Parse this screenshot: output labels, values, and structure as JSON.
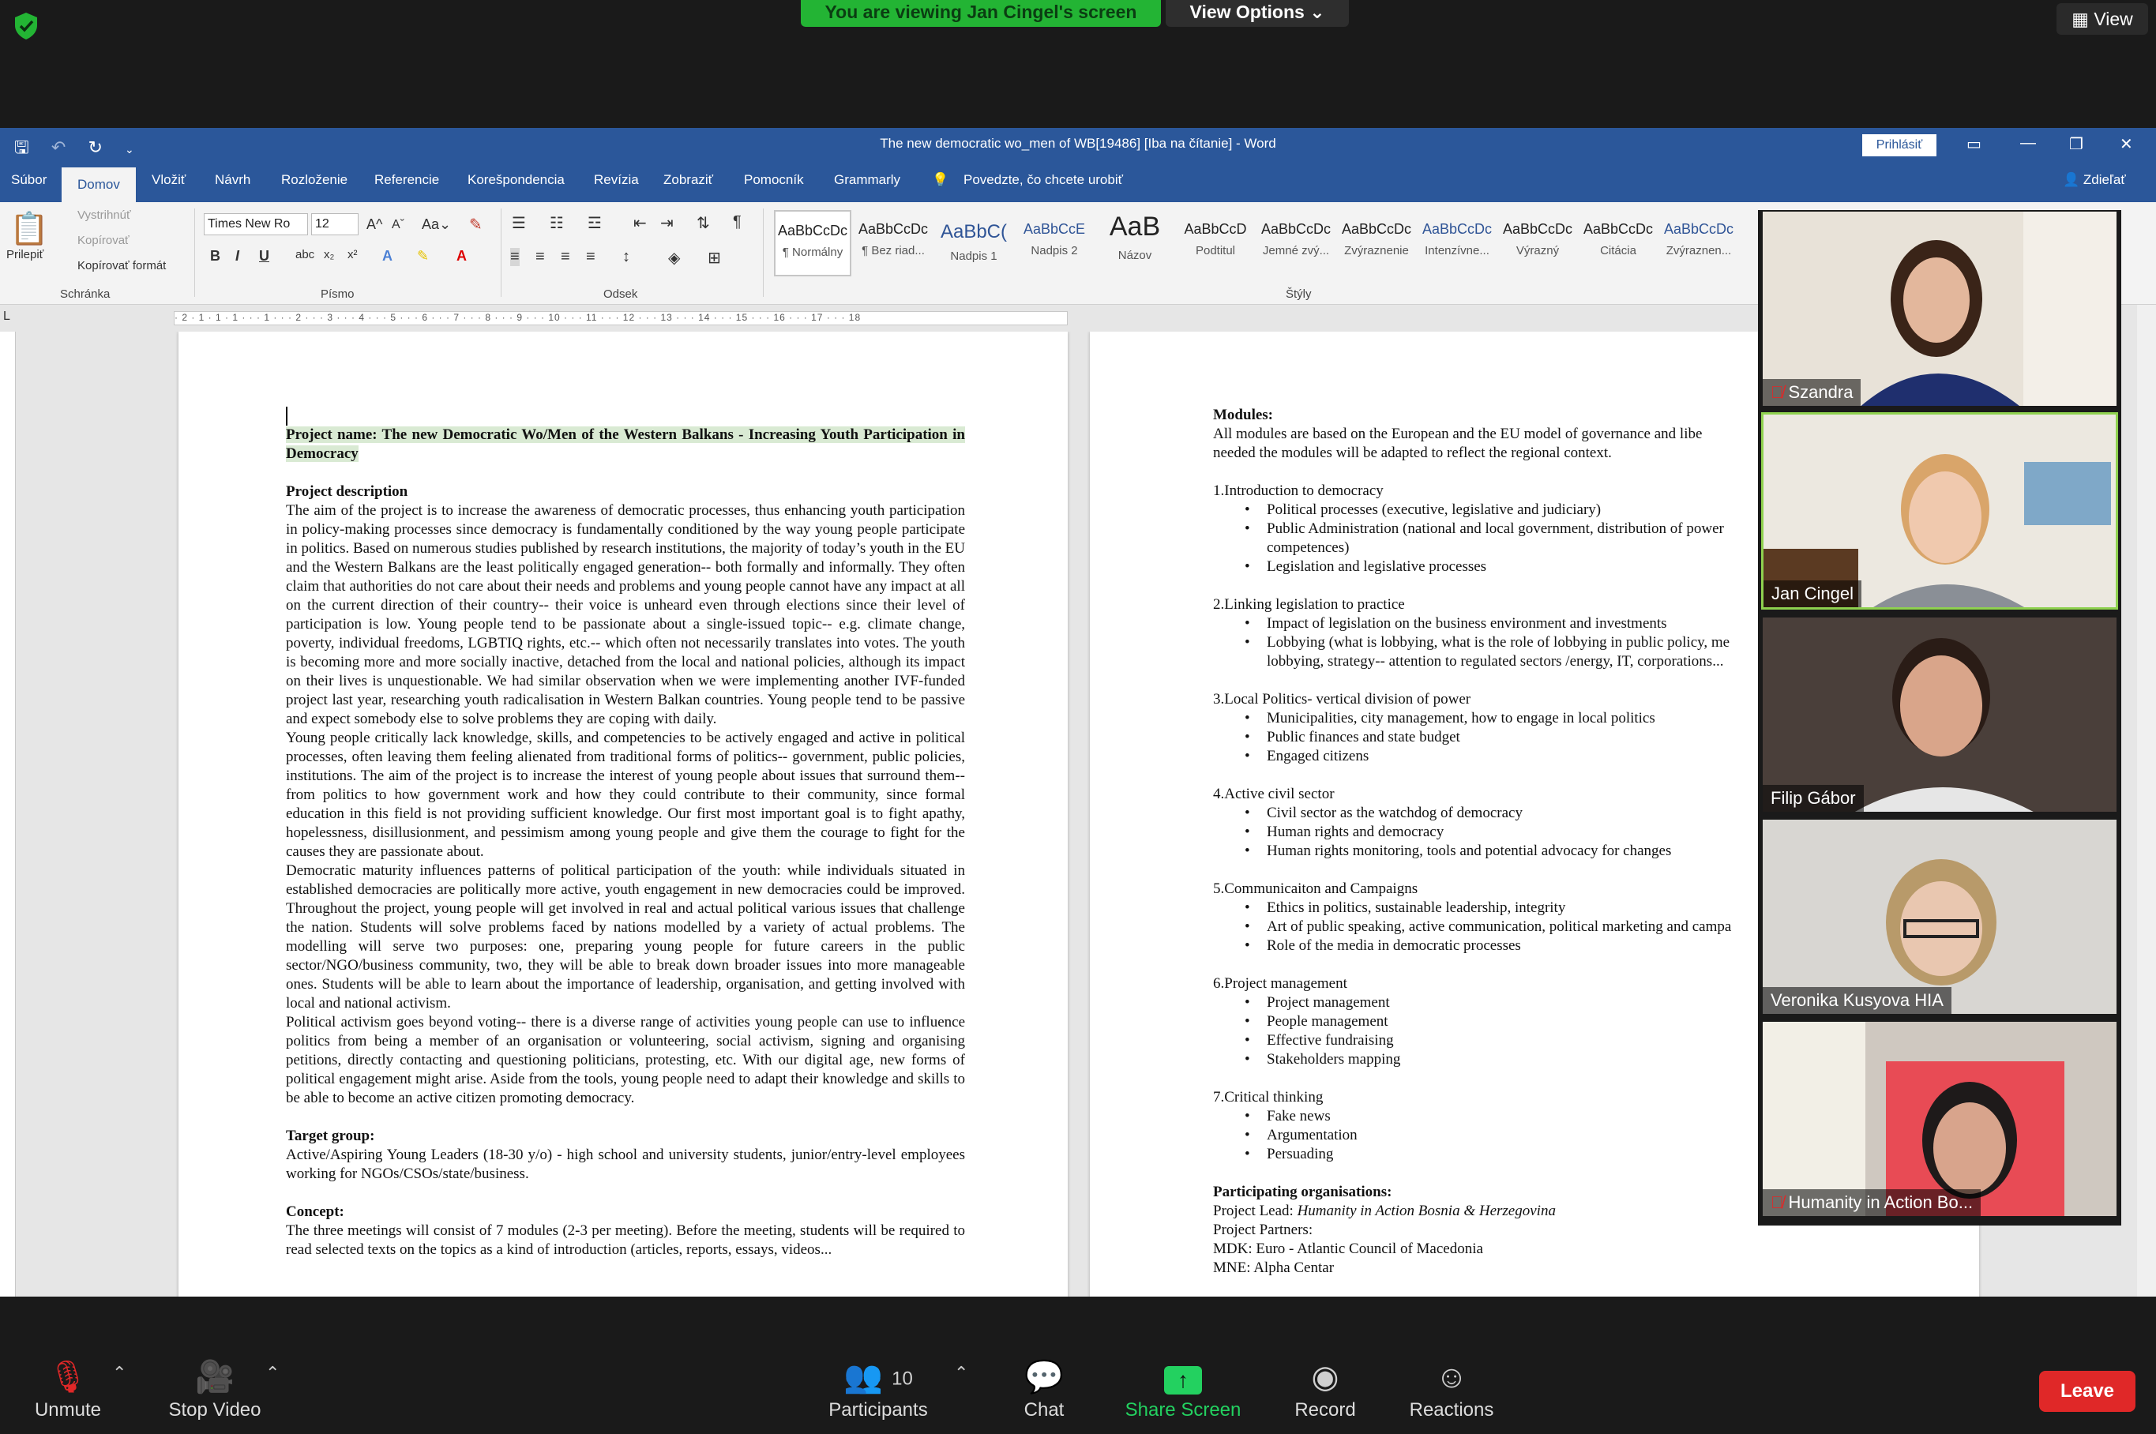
{
  "zoom": {
    "banner": "You are viewing Jan Cingel's screen",
    "view_options": "View Options ⌄",
    "view": "View",
    "controls": {
      "unmute": "Unmute",
      "stop_video": "Stop Video",
      "participants": "Participants",
      "participants_count": "10",
      "chat": "Chat",
      "share_screen": "Share Screen",
      "record": "Record",
      "reactions": "Reactions",
      "leave": "Leave"
    },
    "participants": [
      {
        "name": "Szandra",
        "muted": true
      },
      {
        "name": "Jan Cingel",
        "muted": false
      },
      {
        "name": "Filip Gábor",
        "muted": false
      },
      {
        "name": "Veronika Kusyova HIA",
        "muted": false
      },
      {
        "name": "Humanity in Action Bo...",
        "muted": true
      }
    ]
  },
  "word": {
    "title": "The new democratic wo_men of WB[19486] [Iba na čítanie]  -  Word",
    "login": "Prihlásiť",
    "share": "Zdieľať",
    "tabs": [
      "Súbor",
      "Domov",
      "Vložiť",
      "Návrh",
      "Rozloženie",
      "Referencie",
      "Korešpondencia",
      "Revízia",
      "Zobraziť",
      "Pomocník",
      "Grammarly"
    ],
    "tell_me": "Povedzte, čo chcete urobiť",
    "clipboard": {
      "paste": "Prilepiť",
      "cut": "Vystrihnúť",
      "copy": "Kopírovať",
      "format_painter": "Kopírovať formát",
      "label": "Schránka"
    },
    "font": {
      "name": "Times New Ro",
      "size": "12",
      "label": "Písmo"
    },
    "paragraph_label": "Odsek",
    "styles_label": "Štýly",
    "styles": [
      {
        "sample": "AaBbCcDc",
        "name": "¶ Normálny"
      },
      {
        "sample": "AaBbCcDc",
        "name": "¶ Bez riad..."
      },
      {
        "sample": "AaBbC(",
        "name": "Nadpis 1"
      },
      {
        "sample": "AaBbCcE",
        "name": "Nadpis 2"
      },
      {
        "sample": "AaB",
        "name": "Názov"
      },
      {
        "sample": "AaBbCcD",
        "name": "Podtitul"
      },
      {
        "sample": "AaBbCcDc",
        "name": "Jemné zvý..."
      },
      {
        "sample": "AaBbCcDc",
        "name": "Zvýraznenie"
      },
      {
        "sample": "AaBbCcDc",
        "name": "Intenzívne..."
      },
      {
        "sample": "AaBbCcDc",
        "name": "Výrazný"
      },
      {
        "sample": "AaBbCcDc",
        "name": "Citácia"
      },
      {
        "sample": "AaBbCcDc",
        "name": "Zvýraznen..."
      }
    ],
    "ruler_text": "· 2 · 1 · 1 · 1 · · · 1 · · · 2 · · · 3 · · · 4 · · · 5 · · · 6 · · · 7 · · · 8 · · · 9 · · · 10 · · · 11 · · · 12 · · · 13 · · · 14 · · · 15 · · · 16 · · · 17 · · · 18"
  },
  "page1": {
    "project_name": "Project name: The new Democratic Wo/Men of the Western Balkans - Increasing Youth Participation in Democracy",
    "desc_heading": "Project description",
    "paragraphs": [
      "The aim of the project is to increase the awareness of democratic processes, thus enhancing youth participation in policy-making processes since democracy is fundamentally conditioned by the way young people participate in politics. Based on numerous studies published by research institutions, the majority of today’s youth in the EU and the Western Balkans are the least politically engaged generation-- both formally and informally. They often claim that authorities do not care about their needs and problems and young people cannot have any impact at all on the current direction of their country-- their voice is unheard even through elections since their level of participation is low. Young people tend to be passionate about a single-issued topic-- e.g. climate change, poverty, individual freedoms, LGBTIQ rights, etc.-- which often not necessarily translates into votes. The youth is becoming more and more socially inactive, detached from the local and national policies, although its impact on their lives is unquestionable. We had similar observation when we were implementing another IVF-funded project last year, researching youth radicalisation in Western Balkan countries. Young people tend to be passive and expect somebody else to solve problems they are coping with daily.",
      "Young people critically lack knowledge, skills, and competencies to be actively engaged and active in political processes, often leaving them feeling alienated from traditional forms of politics-- government, public policies, institutions. The aim of the project is to increase the interest of young people about issues that surround them-- from politics to how government work and how they could contribute to their community, since formal education in this field is not providing sufficient knowledge. Our first most important goal is to fight apathy, hopelessness, disillusionment, and pessimism among young people and give them the courage to fight for the causes they are passionate about.",
      "Democratic maturity influences patterns of political participation of the youth: while individuals situated in established democracies are politically more active, youth engagement in new democracies could be improved. Throughout the project, young people will get involved in real and actual political various issues that challenge the nation. Students will solve problems faced by nations modelled by a variety of actual problems. The modelling will serve two purposes: one, preparing young people for future careers in the public sector/NGO/business community, two, they will be able to break down broader issues into more manageable ones. Students will be able to learn about the importance of leadership, organisation, and getting involved with local and national activism.",
      "Political activism goes beyond voting-- there is a diverse range of activities young people can use to influence politics from being a member of an organisation or volunteering, social activism, signing and organising petitions, directly contacting and questioning politicians, protesting, etc. With our digital age, new forms of political engagement might arise. Aside from the tools, young people need to adapt their knowledge and skills to be able to become an active citizen promoting democracy."
    ],
    "target_heading": "Target group:",
    "target_text": "Active/Aspiring Young Leaders (18-30 y/o) - high school and university students, junior/entry-level employees working for NGOs/CSOs/state/business.",
    "concept_heading": "Concept:",
    "concept_text": "The three meetings will consist of 7 modules (2-3 per meeting). Before the meeting, students will be required to read selected texts on the topics as a kind of introduction (articles, reports, essays, videos..."
  },
  "page2": {
    "modules_heading": "Modules:",
    "modules_intro_1": "All modules are based on the European and the EU model of governance and libe",
    "modules_intro_2": "needed the modules will be adapted to reflect the regional context.",
    "modules": [
      {
        "title": "1.Introduction to democracy",
        "items": [
          "Political processes (executive, legislative and judiciary)",
          "Public Administration (national and local government, distribution of power",
          "competences)",
          "Legislation and legislative processes"
        ]
      },
      {
        "title": "2.Linking legislation to practice",
        "items": [
          "Impact of legislation on the business environment and investments",
          "Lobbying (what is lobbying, what is the role of lobbying in public policy, me",
          "lobbying, strategy-- attention to regulated sectors /energy, IT, corporations..."
        ]
      },
      {
        "title": "3.Local Politics- vertical division of power",
        "items": [
          "Municipalities, city management, how to engage in local politics",
          "Public finances and state budget",
          "Engaged citizens"
        ]
      },
      {
        "title": "4.Active civil sector",
        "items": [
          "Civil sector as the watchdog of democracy",
          "Human rights and democracy",
          "Human rights monitoring, tools and potential advocacy for changes"
        ]
      },
      {
        "title": "5.Communicaiton and Campaigns",
        "items": [
          "Ethics in politics, sustainable leadership, integrity",
          "Art of public speaking, active communication, political marketing and campa",
          "Role of the media in democratic processes"
        ]
      },
      {
        "title": "6.Project management",
        "items": [
          "Project management",
          "People management",
          "Effective fundraising",
          "Stakeholders mapping"
        ]
      },
      {
        "title": "7.Critical thinking",
        "items": [
          "Fake news",
          "Argumentation",
          "Persuading"
        ]
      }
    ],
    "orgs_heading": "Participating organisations:",
    "lead_label": "Project Lead: ",
    "lead_value": "Humanity in Action Bosnia & Herzegovina",
    "partners_label": "Project Partners:",
    "partners": [
      "MDK: Euro - Atlantic Council of Macedonia",
      "MNE: Alpha Centar"
    ]
  }
}
